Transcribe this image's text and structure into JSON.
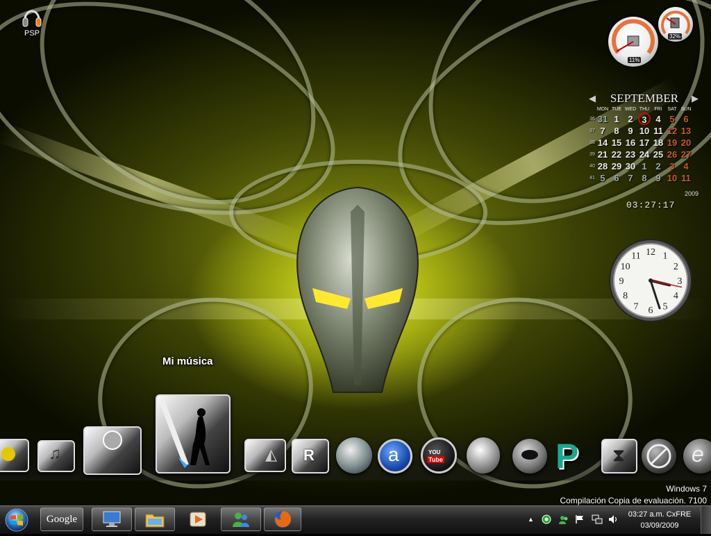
{
  "desktop": {
    "icons": [
      {
        "label": "PSP",
        "icon": "headphones-icon"
      }
    ]
  },
  "gadgets": {
    "cpu_meter": {
      "cpu_percent": "11%",
      "ram_percent": "32%",
      "cpu": 11,
      "ram": 32
    },
    "calendar": {
      "month": "SEPTEMBER",
      "year": "2009",
      "weekdays": [
        "MON",
        "TUE",
        "WED",
        "THU",
        "FRI",
        "SAT",
        "SUN"
      ],
      "weeks": [
        {
          "wk": "36",
          "days": [
            "31",
            "1",
            "2",
            "3",
            "4",
            "5",
            "6"
          ]
        },
        {
          "wk": "37",
          "days": [
            "7",
            "8",
            "9",
            "10",
            "11",
            "12",
            "13"
          ]
        },
        {
          "wk": "38",
          "days": [
            "14",
            "15",
            "16",
            "17",
            "18",
            "19",
            "20"
          ]
        },
        {
          "wk": "39",
          "days": [
            "21",
            "22",
            "23",
            "24",
            "25",
            "26",
            "27"
          ]
        },
        {
          "wk": "40",
          "days": [
            "28",
            "29",
            "30",
            "1",
            "2",
            "3",
            "4"
          ]
        },
        {
          "wk": "41",
          "days": [
            "5",
            "6",
            "7",
            "8",
            "9",
            "10",
            "11"
          ]
        }
      ],
      "today": "3",
      "time": "03:27:17"
    },
    "clock": {
      "hour": 3,
      "minute": 27,
      "second": 17,
      "numerals": [
        "12",
        "1",
        "2",
        "3",
        "4",
        "5",
        "6",
        "7",
        "8",
        "9",
        "10",
        "11"
      ]
    }
  },
  "dock": {
    "hover_label": "Mi música",
    "items": [
      {
        "name": "dock-item-1",
        "icon": "app-tile-icon"
      },
      {
        "name": "dock-item-2",
        "icon": "music-note-icon"
      },
      {
        "name": "dock-item-3",
        "icon": "user-folder-icon"
      },
      {
        "name": "dock-item-4",
        "icon": "my-music-icon"
      },
      {
        "name": "dock-item-5",
        "icon": "document-icon"
      },
      {
        "name": "dock-item-6",
        "icon": "r-logo-icon"
      },
      {
        "name": "dock-item-7",
        "icon": "globe-network-icon"
      },
      {
        "name": "dock-item-8",
        "icon": "a-circle-icon"
      },
      {
        "name": "dock-item-9",
        "icon": "youtube-icon"
      },
      {
        "name": "dock-item-10",
        "icon": "swirl-icon"
      },
      {
        "name": "dock-item-11",
        "icon": "alien-icon"
      },
      {
        "name": "dock-item-12",
        "icon": "p-logo-icon"
      },
      {
        "name": "dock-item-13",
        "icon": "hourglass-icon"
      },
      {
        "name": "dock-item-14",
        "icon": "no-sign-icon"
      },
      {
        "name": "dock-item-15",
        "icon": "ie-browser-icon"
      }
    ]
  },
  "watermark": {
    "line1": "Windows 7",
    "line2": "Compilación Copia de evaluación. 7100"
  },
  "taskbar": {
    "start": "windows-orb-icon",
    "google_label": "Google",
    "buttons": [
      "google-button",
      "remote-desktop-icon",
      "explorer-folder-icon",
      "media-player-icon",
      "windows-live-messenger-icon",
      "firefox-icon"
    ],
    "tray_icons": [
      "show-hidden-icon",
      "circle-app-icon",
      "messenger-tray-icon",
      "action-center-flag-icon",
      "network-icon",
      "volume-icon"
    ],
    "time": "03:27 a.m. CxFRE",
    "date": "03/09/2009"
  },
  "colors": {
    "accent": "#c8d214",
    "today_ring": "#c01010",
    "weekend": "#c45a2a"
  }
}
